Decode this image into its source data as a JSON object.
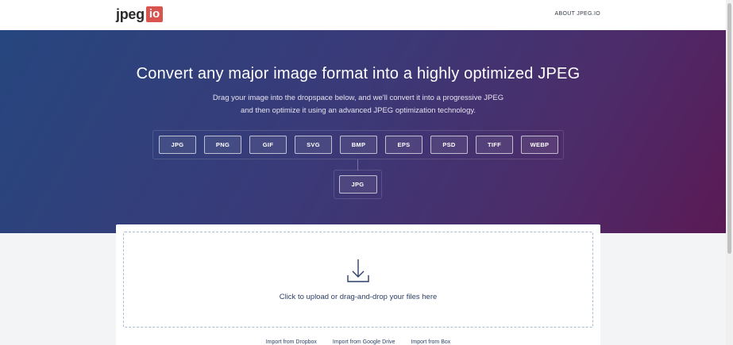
{
  "header": {
    "logo_main": "jpeg",
    "logo_badge": "io",
    "about_label": "ABOUT JPEG.IO"
  },
  "hero": {
    "title": "Convert any major image format into a highly optimized JPEG",
    "subtitle_line1": "Drag your image into the dropspace below, and we'll convert it into a progressive JPEG",
    "subtitle_line2": "and then optimize it using an advanced JPEG optimization technology.",
    "formats": [
      "JPG",
      "PNG",
      "GIF",
      "SVG",
      "BMP",
      "EPS",
      "PSD",
      "TIFF",
      "WEBP"
    ],
    "target_format": "JPG"
  },
  "upload": {
    "icon": "download-arrow-icon",
    "text": "Click to upload or drag-and-drop your files here",
    "imports": [
      "Import from Dropbox",
      "Import from Google Drive",
      "Import from Box"
    ]
  },
  "colors": {
    "logo_badge": "#d9534f",
    "hero_start": "#26467f",
    "hero_end": "#5a1a55",
    "link_text": "#2c3e66"
  }
}
